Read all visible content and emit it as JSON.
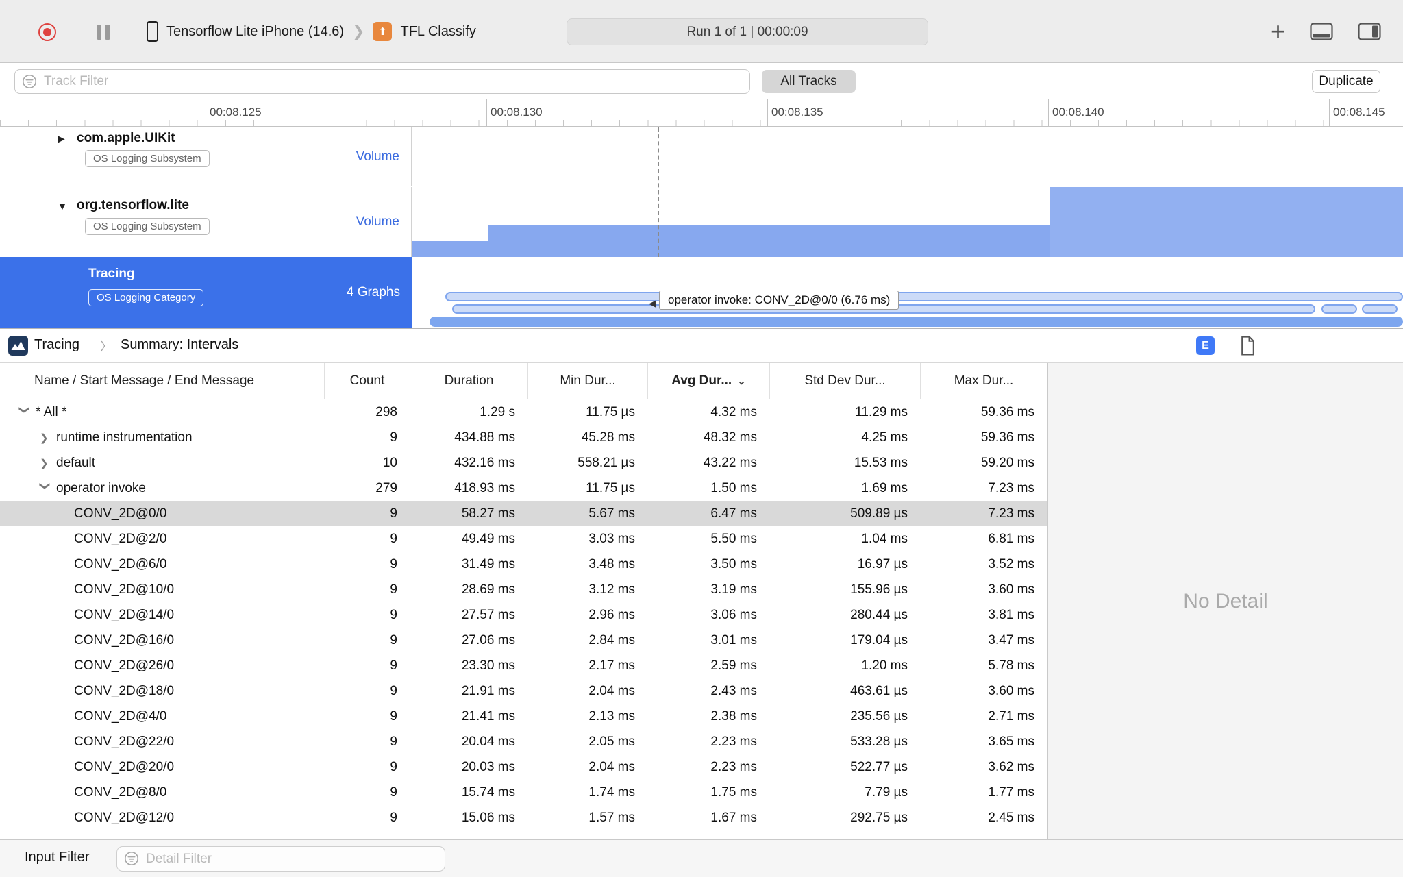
{
  "toolbar": {
    "device": "Tensorflow Lite iPhone (14.6)",
    "app": "TFL Classify",
    "run_status": "Run 1 of 1  |  00:00:09"
  },
  "filter_bar": {
    "track_filter_placeholder": "Track Filter",
    "all_tracks": "All Tracks",
    "duplicate": "Duplicate"
  },
  "ruler": {
    "ticks": [
      "00:08.125",
      "00:08.130",
      "00:08.135",
      "00:08.140",
      "00:08.145"
    ]
  },
  "tracks": [
    {
      "name": "com.apple.UIKit",
      "badge": "OS Logging Subsystem",
      "meta": "Volume",
      "state": "collapsed"
    },
    {
      "name": "org.tensorflow.lite",
      "badge": "OS Logging Subsystem",
      "meta": "Volume",
      "state": "expanded"
    },
    {
      "name": "Tracing",
      "badge": "OS Logging Category",
      "meta": "4 Graphs",
      "state": "selected"
    }
  ],
  "tooltip": "operator invoke: CONV_2D@0/0 (6.76 ms)",
  "detail_header": {
    "breadcrumb_root": "Tracing",
    "breadcrumb_page": "Summary: Intervals",
    "e_badge": "E"
  },
  "table": {
    "columns": {
      "name": "Name / Start Message / End Message",
      "count": "Count",
      "duration": "Duration",
      "min": "Min Dur...",
      "avg": "Avg Dur...",
      "std": "Std Dev Dur...",
      "max": "Max Dur..."
    },
    "sort_column": "avg",
    "rows": [
      {
        "name": "* All *",
        "level": 0,
        "disclosure": "down",
        "count": "298",
        "duration": "1.29 s",
        "min": "11.75 µs",
        "avg": "4.32 ms",
        "std": "11.29 ms",
        "max": "59.36 ms"
      },
      {
        "name": "runtime instrumentation",
        "level": 1,
        "disclosure": "right",
        "count": "9",
        "duration": "434.88 ms",
        "min": "45.28 ms",
        "avg": "48.32 ms",
        "std": "4.25 ms",
        "max": "59.36 ms"
      },
      {
        "name": "default",
        "level": 1,
        "disclosure": "right",
        "count": "10",
        "duration": "432.16 ms",
        "min": "558.21 µs",
        "avg": "43.22 ms",
        "std": "15.53 ms",
        "max": "59.20 ms"
      },
      {
        "name": "operator invoke",
        "level": 1,
        "disclosure": "down",
        "count": "279",
        "duration": "418.93 ms",
        "min": "11.75 µs",
        "avg": "1.50 ms",
        "std": "1.69 ms",
        "max": "7.23 ms"
      },
      {
        "name": "CONV_2D@0/0",
        "level": 2,
        "selected": true,
        "count": "9",
        "duration": "58.27 ms",
        "min": "5.67 ms",
        "avg": "6.47 ms",
        "std": "509.89 µs",
        "max": "7.23 ms"
      },
      {
        "name": "CONV_2D@2/0",
        "level": 2,
        "count": "9",
        "duration": "49.49 ms",
        "min": "3.03 ms",
        "avg": "5.50 ms",
        "std": "1.04 ms",
        "max": "6.81 ms"
      },
      {
        "name": "CONV_2D@6/0",
        "level": 2,
        "count": "9",
        "duration": "31.49 ms",
        "min": "3.48 ms",
        "avg": "3.50 ms",
        "std": "16.97 µs",
        "max": "3.52 ms"
      },
      {
        "name": "CONV_2D@10/0",
        "level": 2,
        "count": "9",
        "duration": "28.69 ms",
        "min": "3.12 ms",
        "avg": "3.19 ms",
        "std": "155.96 µs",
        "max": "3.60 ms"
      },
      {
        "name": "CONV_2D@14/0",
        "level": 2,
        "count": "9",
        "duration": "27.57 ms",
        "min": "2.96 ms",
        "avg": "3.06 ms",
        "std": "280.44 µs",
        "max": "3.81 ms"
      },
      {
        "name": "CONV_2D@16/0",
        "level": 2,
        "count": "9",
        "duration": "27.06 ms",
        "min": "2.84 ms",
        "avg": "3.01 ms",
        "std": "179.04 µs",
        "max": "3.47 ms"
      },
      {
        "name": "CONV_2D@26/0",
        "level": 2,
        "count": "9",
        "duration": "23.30 ms",
        "min": "2.17 ms",
        "avg": "2.59 ms",
        "std": "1.20 ms",
        "max": "5.78 ms"
      },
      {
        "name": "CONV_2D@18/0",
        "level": 2,
        "count": "9",
        "duration": "21.91 ms",
        "min": "2.04 ms",
        "avg": "2.43 ms",
        "std": "463.61 µs",
        "max": "3.60 ms"
      },
      {
        "name": "CONV_2D@4/0",
        "level": 2,
        "count": "9",
        "duration": "21.41 ms",
        "min": "2.13 ms",
        "avg": "2.38 ms",
        "std": "235.56 µs",
        "max": "2.71 ms"
      },
      {
        "name": "CONV_2D@22/0",
        "level": 2,
        "count": "9",
        "duration": "20.04 ms",
        "min": "2.05 ms",
        "avg": "2.23 ms",
        "std": "533.28 µs",
        "max": "3.65 ms"
      },
      {
        "name": "CONV_2D@20/0",
        "level": 2,
        "count": "9",
        "duration": "20.03 ms",
        "min": "2.04 ms",
        "avg": "2.23 ms",
        "std": "522.77 µs",
        "max": "3.62 ms"
      },
      {
        "name": "CONV_2D@8/0",
        "level": 2,
        "count": "9",
        "duration": "15.74 ms",
        "min": "1.74 ms",
        "avg": "1.75 ms",
        "std": "7.79 µs",
        "max": "1.77 ms"
      },
      {
        "name": "CONV_2D@12/0",
        "level": 2,
        "count": "9",
        "duration": "15.06 ms",
        "min": "1.57 ms",
        "avg": "1.67 ms",
        "std": "292.75 µs",
        "max": "2.45 ms"
      }
    ]
  },
  "detail_panel": {
    "empty_text": "No Detail"
  },
  "bottom_bar": {
    "label": "Input Filter",
    "detail_filter_placeholder": "Detail Filter"
  },
  "glyphs": {
    "collapsed_triangle": "▶",
    "expanded_triangle": "▼",
    "row_chevron": "❯",
    "toolbar_separator": "❯",
    "breadcrumb_separator": "〉",
    "sort_chevron": "⌄",
    "plus": "+",
    "app_arrow": "⬆",
    "tooltip_pointer": "◀"
  },
  "colors": {
    "accent_blue": "#3b71e9",
    "chart_blue": "#87a8ef",
    "record_red": "#df4340",
    "selected_row": "#d9d9d9",
    "app_icon_orange": "#e8873d"
  }
}
